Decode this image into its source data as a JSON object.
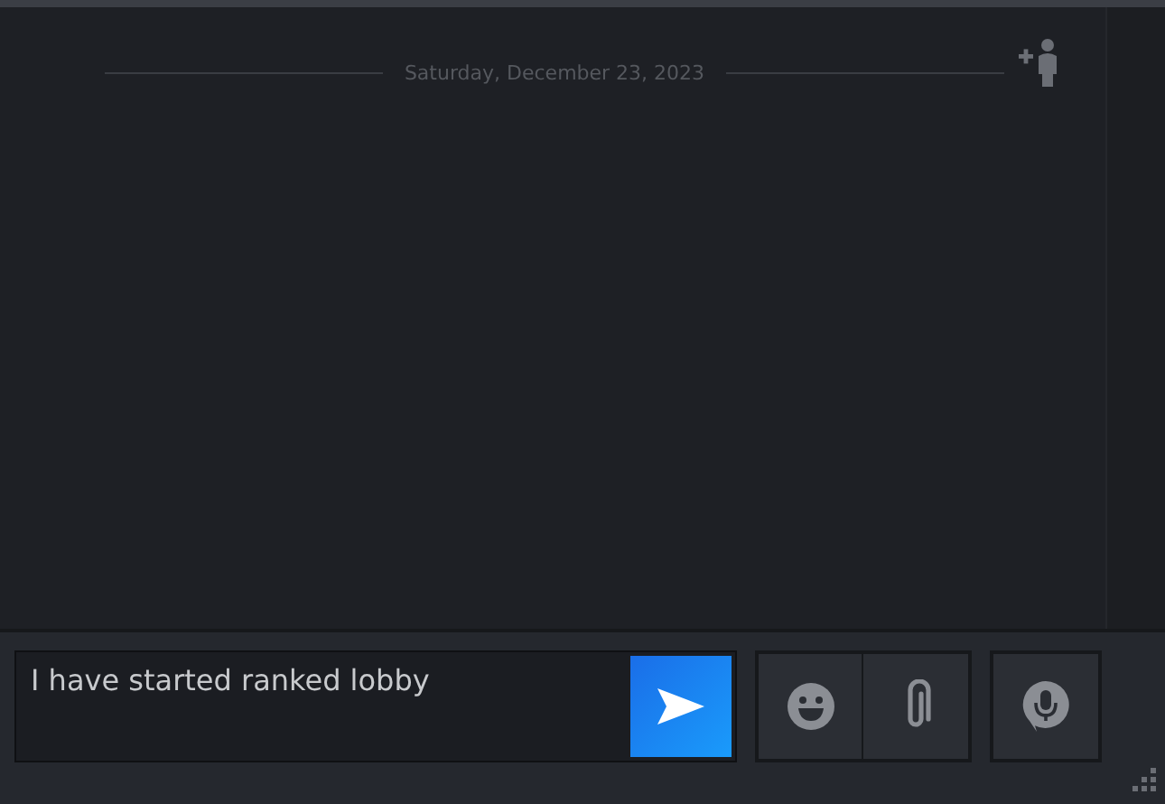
{
  "chat": {
    "date_divider": "Saturday, December 23, 2023"
  },
  "composer": {
    "value": "I have started ranked lobby"
  }
}
